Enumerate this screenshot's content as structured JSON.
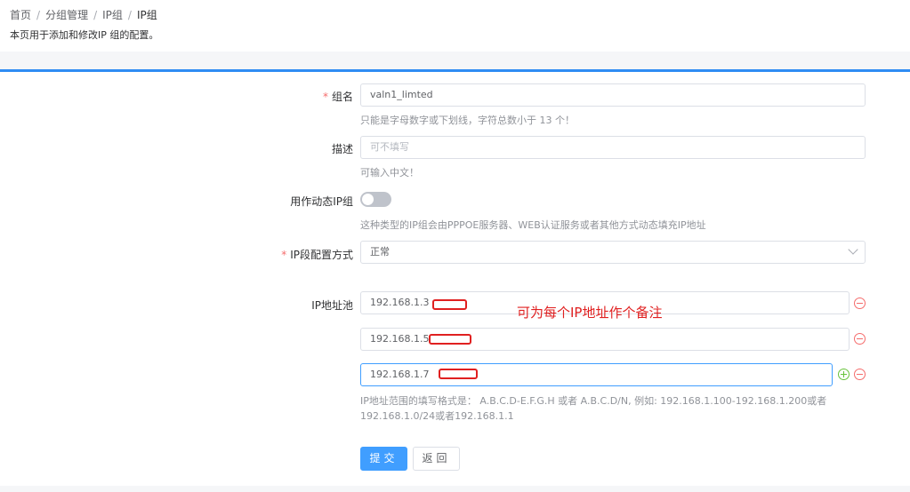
{
  "breadcrumb": {
    "items": [
      "首页",
      "分组管理",
      "IP组"
    ],
    "current": "IP组",
    "separator": "/"
  },
  "page_description": "本页用于添加和修改IP 组的配置。",
  "form": {
    "group_name": {
      "label": "组名",
      "value": "valn1_limted",
      "hint": "只能是字母数字或下划线，字符总数小于 13 个！"
    },
    "description": {
      "label": "描述",
      "placeholder": "可不填写",
      "hint": "可输入中文！"
    },
    "dynamic": {
      "label": "用作动态IP组",
      "enabled": false,
      "hint": "这种类型的IP组会由PPPOE服务器、WEB认证服务或者其他方式动态填充IP地址"
    },
    "ip_config_mode": {
      "label": "IP段配置方式",
      "value": "正常"
    },
    "ip_pool": {
      "label": "IP地址池",
      "entries": [
        "192.168.1.3",
        "192.168.1.5",
        "192.168.1.7"
      ],
      "hint_line1": "IP地址范围的填写格式是： A.B.C.D-E.F.G.H 或者 A.B.C.D/N, 例如: 192.168.1.100-192.168.1.200或者",
      "hint_line2": "192.168.1.0/24或者192.168.1.1"
    },
    "annotation": "可为每个IP地址作个备注",
    "submit_label": "提交",
    "back_label": "返回"
  },
  "colors": {
    "primary": "#409eff",
    "accent_line": "#2f8cf3",
    "required": "#f56c6c",
    "annotation": "#e02020",
    "add": "#67c23a"
  }
}
